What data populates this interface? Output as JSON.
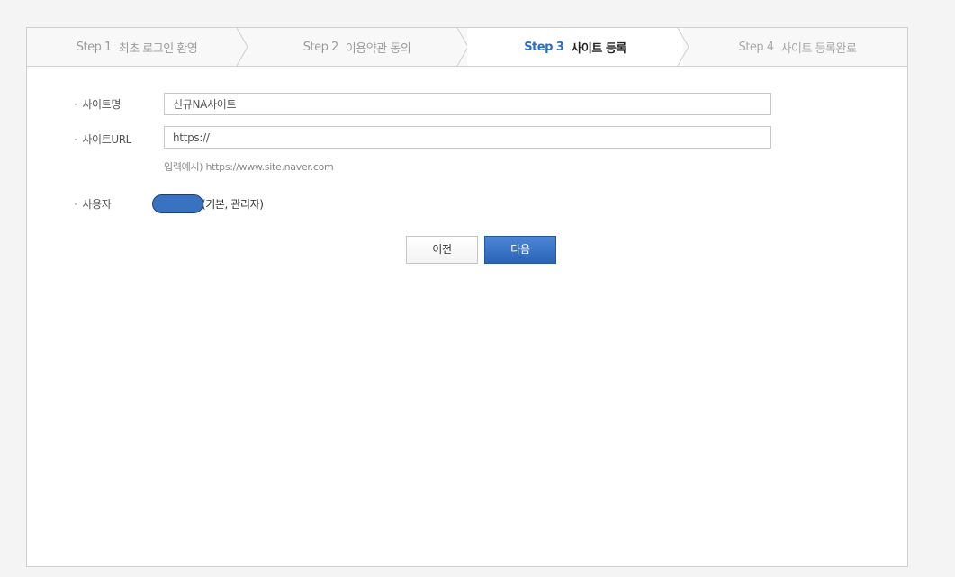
{
  "steps": [
    {
      "num": "Step 1",
      "title": "최초 로그인 환영",
      "state": "done"
    },
    {
      "num": "Step 2",
      "title": "이용약관 동의",
      "state": "done"
    },
    {
      "num": "Step 3",
      "title": "사이트 등록",
      "state": "active"
    },
    {
      "num": "Step 4",
      "title": "사이트 등록완료",
      "state": "todo"
    }
  ],
  "form": {
    "site_name_label": "사이트명",
    "site_name_value": "신규NA사이트",
    "site_url_label": "사이트URL",
    "site_url_value": "https://",
    "site_url_hint": "입력예시) https://www.site.naver.com",
    "user_label": "사용자",
    "user_role": "(기본, 관리자)"
  },
  "buttons": {
    "prev_label": "이전",
    "next_label": "다음"
  },
  "colors": {
    "accent": "#2d6dc4",
    "next_button": "#3a72c2"
  }
}
